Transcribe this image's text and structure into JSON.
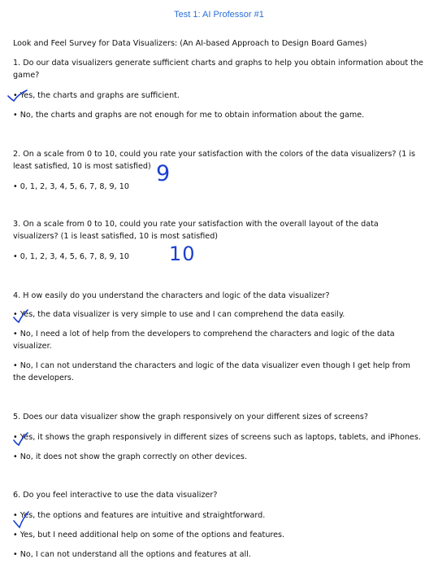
{
  "header": {
    "title": "Test 1: AI Professor #1"
  },
  "survey": {
    "title": "Look and Feel Survey for Data Visualizers: (An AI-based Approach to Design Board Games)",
    "q1": {
      "text": "1. Do our data visualizers generate sufficient charts and graphs to help you obtain information about the game?",
      "opt1": "• Yes, the charts and graphs are sufficient.",
      "opt2": "• No, the charts and graphs are not enough for me to obtain information about the game."
    },
    "q2": {
      "text": "2. On a scale from 0 to 10, could you rate your satisfaction with the colors of the data visualizers? (1 is least satisfied, 10 is most satisfied)",
      "scale": "• 0, 1, 2, 3, 4, 5, 6, 7, 8, 9, 10",
      "answer": "9"
    },
    "q3": {
      "text": "3. On a scale from 0 to 10, could you rate your satisfaction with the overall layout of the data visualizers? (1 is least satisfied, 10 is most satisfied)",
      "scale": "• 0, 1, 2, 3, 4, 5, 6, 7, 8, 9, 10",
      "answer": "10"
    },
    "q4": {
      "text": "4. H ow easily do you understand the characters and logic of the data visualizer?",
      "opt1": "• Yes, the data visualizer is very simple to use and I can comprehend the data easily.",
      "opt2": "• No, I need a lot of help from the developers to comprehend the characters and logic of the data visualizer.",
      "opt3": "• No, I can not understand the characters and logic of the data visualizer even though I get help from the developers."
    },
    "q5": {
      "text": "5. Does our data visualizer show the graph responsively on your different sizes of screens?",
      "opt1": "• Yes, it shows the graph responsively in different sizes of screens such as laptops, tablets, and iPhones.",
      "opt2": "• No, it does not show the graph correctly on other devices."
    },
    "q6": {
      "text": "6. Do you feel interactive to use the data visualizer?",
      "opt1": "• Yes, the options and features are intuitive and straightforward.",
      "opt2": "• Yes, but I need additional help on some of the options and features.",
      "opt3": "• No, I can not understand all the options and features at all."
    }
  },
  "colors": {
    "header": "#2a6fd6",
    "ink": "#1a3fd0",
    "text": "#111111"
  }
}
